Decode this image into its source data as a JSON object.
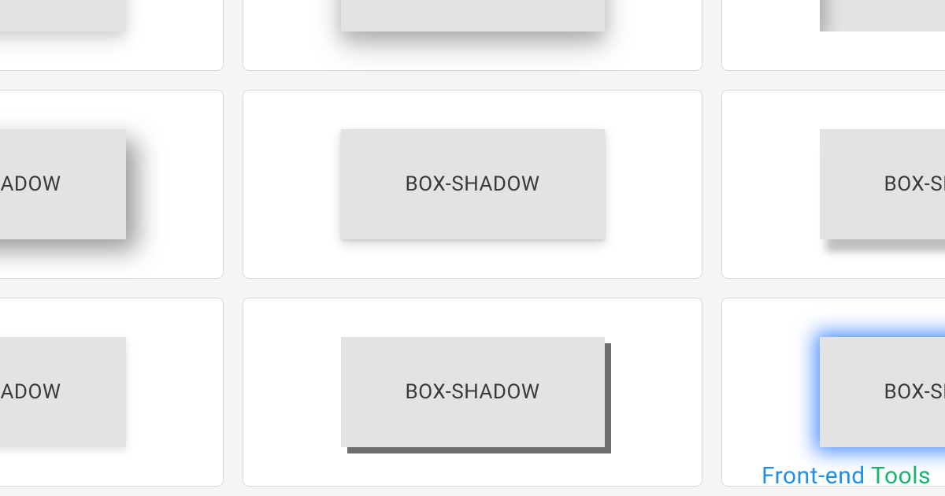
{
  "swatch_label": "BOX-SHADOW",
  "watermark": {
    "left": "Front-end ",
    "right": "Tools"
  },
  "cells": [
    {
      "shadow_class": "s0"
    },
    {
      "shadow_class": "s1"
    },
    {
      "shadow_class": "s2"
    },
    {
      "shadow_class": "s3"
    },
    {
      "shadow_class": "s4"
    },
    {
      "shadow_class": "s5"
    },
    {
      "shadow_class": "s6"
    },
    {
      "shadow_class": "s7"
    },
    {
      "shadow_class": "s8"
    }
  ]
}
